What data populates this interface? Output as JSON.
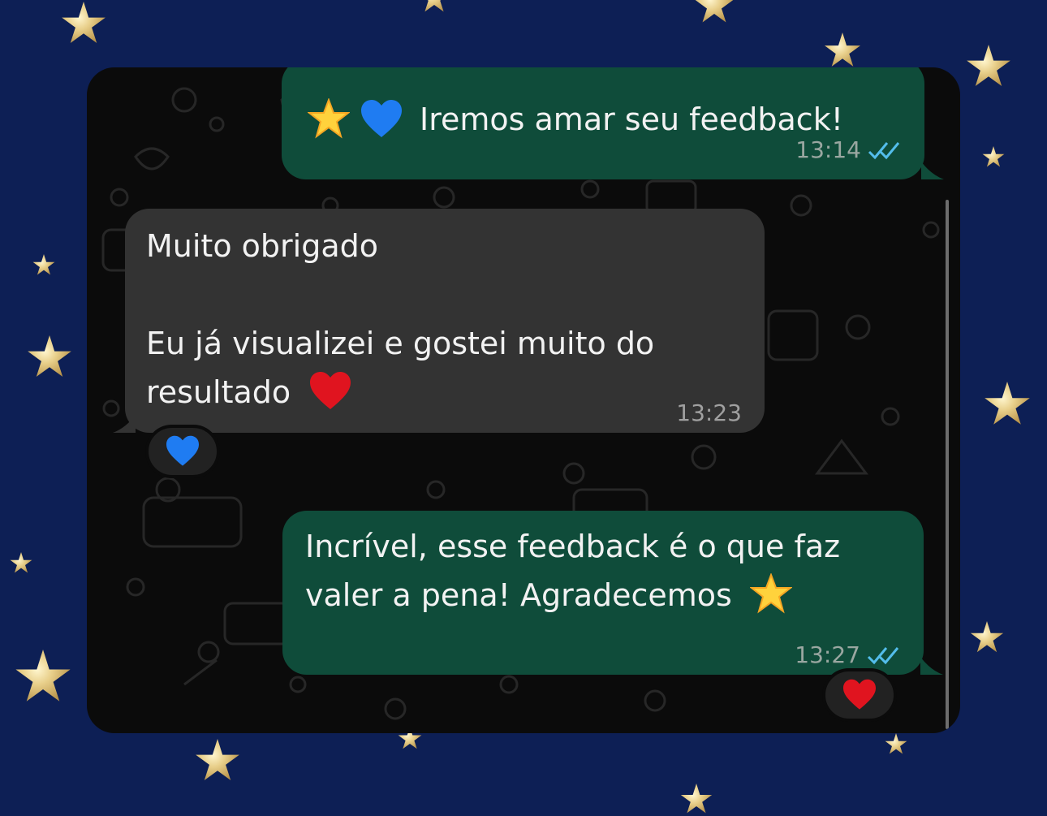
{
  "messages": [
    {
      "direction": "outgoing",
      "text": "Iremos amar seu feedback!",
      "emojis_before": [
        "star-emoji",
        "blue-heart-emoji"
      ],
      "time": "13:14",
      "status": "read"
    },
    {
      "direction": "incoming",
      "lines": [
        "Muito obrigado",
        "",
        "Eu já visualizei e gostei muito do",
        "resultado"
      ],
      "emoji_after": "red-heart-emoji",
      "time": "13:23",
      "reaction": "blue-heart-emoji"
    },
    {
      "direction": "outgoing",
      "lines": [
        "Incrível, esse feedback é o que faz",
        "valer a pena! Agradecemos"
      ],
      "emoji_after": "star-emoji",
      "time": "13:27",
      "status": "read",
      "reaction": "red-heart-emoji"
    }
  ],
  "colors": {
    "outgoing_bubble": "#0f4c3a",
    "incoming_bubble": "#333333",
    "read_ticks": "#53bdeb",
    "background": "#0d1f55"
  }
}
